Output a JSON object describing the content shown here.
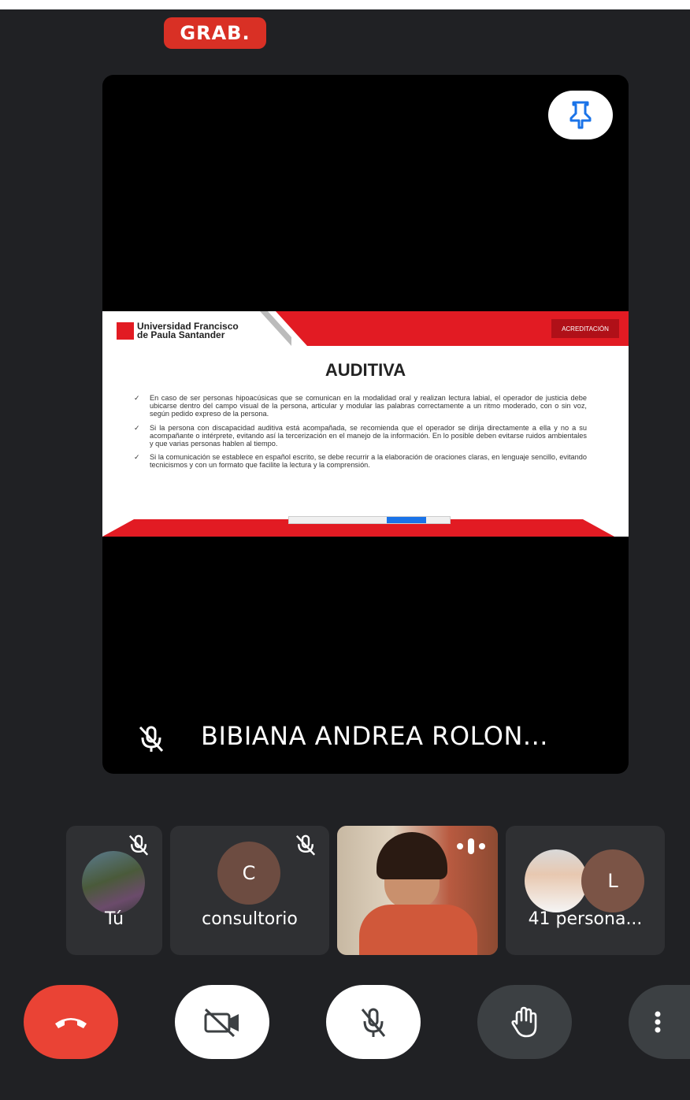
{
  "status": {
    "recording_badge": "GRAB."
  },
  "main_tile": {
    "presenter_name": "BIBIANA ANDREA ROLON...",
    "pin_icon": "pin-icon",
    "mic_icon": "mic-off-icon",
    "slide": {
      "logo_line1": "Universidad Francisco",
      "logo_line2": "de Paula Santander",
      "right_logo": "ACREDITACIÓN",
      "title": "AUDITIVA",
      "bullets": [
        "En caso de ser personas hipoacúsicas que se comunican en la modalidad oral y realizan lectura labial, el operador de justicia debe ubicarse dentro del campo visual de la persona, articular y modular las palabras correctamente a un ritmo moderado, con o sin voz, según pedido expreso de la persona.",
        "Si la persona con discapacidad auditiva está acompañada, se recomienda que el operador se dirija directamente a ella y no a su acompañante o intérprete, evitando así la tercerización en el manejo de la información. En lo posible deben evitarse ruidos ambientales y que varias personas hablen al tiempo.",
        "Si la comunicación se establece en español escrito, se debe recurrir a la elaboración de oraciones claras, en lenguaje sencillo, evitando tecnicismos y con un formato que facilite la lectura y la comprensión."
      ]
    }
  },
  "participants": [
    {
      "label": "Tú",
      "avatar": "photo",
      "muted": true
    },
    {
      "label": "consultorio",
      "avatar_letter": "C",
      "muted": true
    },
    {
      "label": "",
      "avatar": "video",
      "speaking": true
    },
    {
      "label": "41 persona...",
      "avatar_letter": "L"
    }
  ],
  "controls": {
    "end_call": "end-call-icon",
    "camera": "camera-off-icon",
    "mic": "mic-off-icon",
    "hand": "raise-hand-icon",
    "more": "more-vert-icon"
  },
  "colors": {
    "accent_red": "#ea4335",
    "background": "#202124",
    "tile": "#2f3033"
  }
}
